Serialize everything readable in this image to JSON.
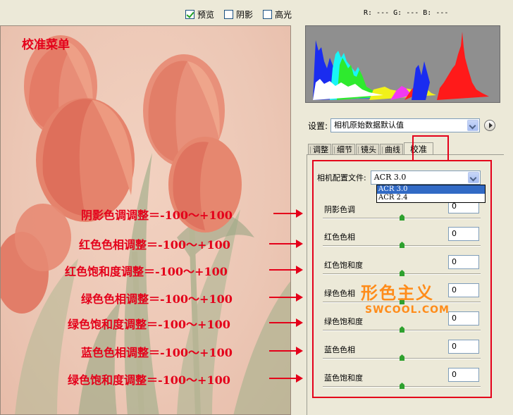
{
  "toolbar": {
    "preview_label": "预览",
    "shadows_label": "阴影",
    "highlights_label": "高光",
    "preview_checked": true,
    "shadows_checked": false,
    "highlights_checked": false,
    "rgb_readout": "R: ---  G: ---  B: ---"
  },
  "preview": {
    "overlay_title": "校准菜单"
  },
  "annotations": [
    "阴影色调调整＝-100～+100",
    "红色色相调整＝-100～+100",
    "红色饱和度调整＝-100～+100",
    "绿色色相调整＝-100～+100",
    "绿色饱和度调整＝-100～+100",
    "蓝色色相调整＝-100～+100",
    "绿色饱和度调整＝-100～+100"
  ],
  "settings": {
    "label": "设置:",
    "value": "相机原始数据默认值"
  },
  "tabs": [
    {
      "label": "调整",
      "active": false
    },
    {
      "label": "细节",
      "active": false
    },
    {
      "label": "镜头",
      "active": false
    },
    {
      "label": "曲线",
      "active": false
    },
    {
      "label": "校准",
      "active": true
    }
  ],
  "calibration": {
    "profile_label": "相机配置文件:",
    "profile_value": "ACR 3.0",
    "profile_options": [
      "ACR 3.0",
      "ACR 2.4"
    ],
    "params": [
      {
        "label": "阴影色调",
        "value": "0",
        "slider": 0.5
      },
      {
        "label": "红色色相",
        "value": "0",
        "slider": 0.5
      },
      {
        "label": "红色饱和度",
        "value": "0",
        "slider": 0.5
      },
      {
        "label": "绿色色相",
        "value": "0",
        "slider": 0.5
      },
      {
        "label": "绿色饱和度",
        "value": "0",
        "slider": 0.5
      },
      {
        "label": "蓝色色相",
        "value": "0",
        "slider": 0.5
      },
      {
        "label": "蓝色饱和度",
        "value": "0",
        "slider": 0.5
      }
    ]
  },
  "watermark": {
    "logo_text": "形色主义",
    "site_text": "SWCOOL.COM"
  },
  "colors": {
    "annotation_red": "#e4001a",
    "watermark_orange": "#ff8c1a",
    "selection_blue": "#316ac5"
  }
}
